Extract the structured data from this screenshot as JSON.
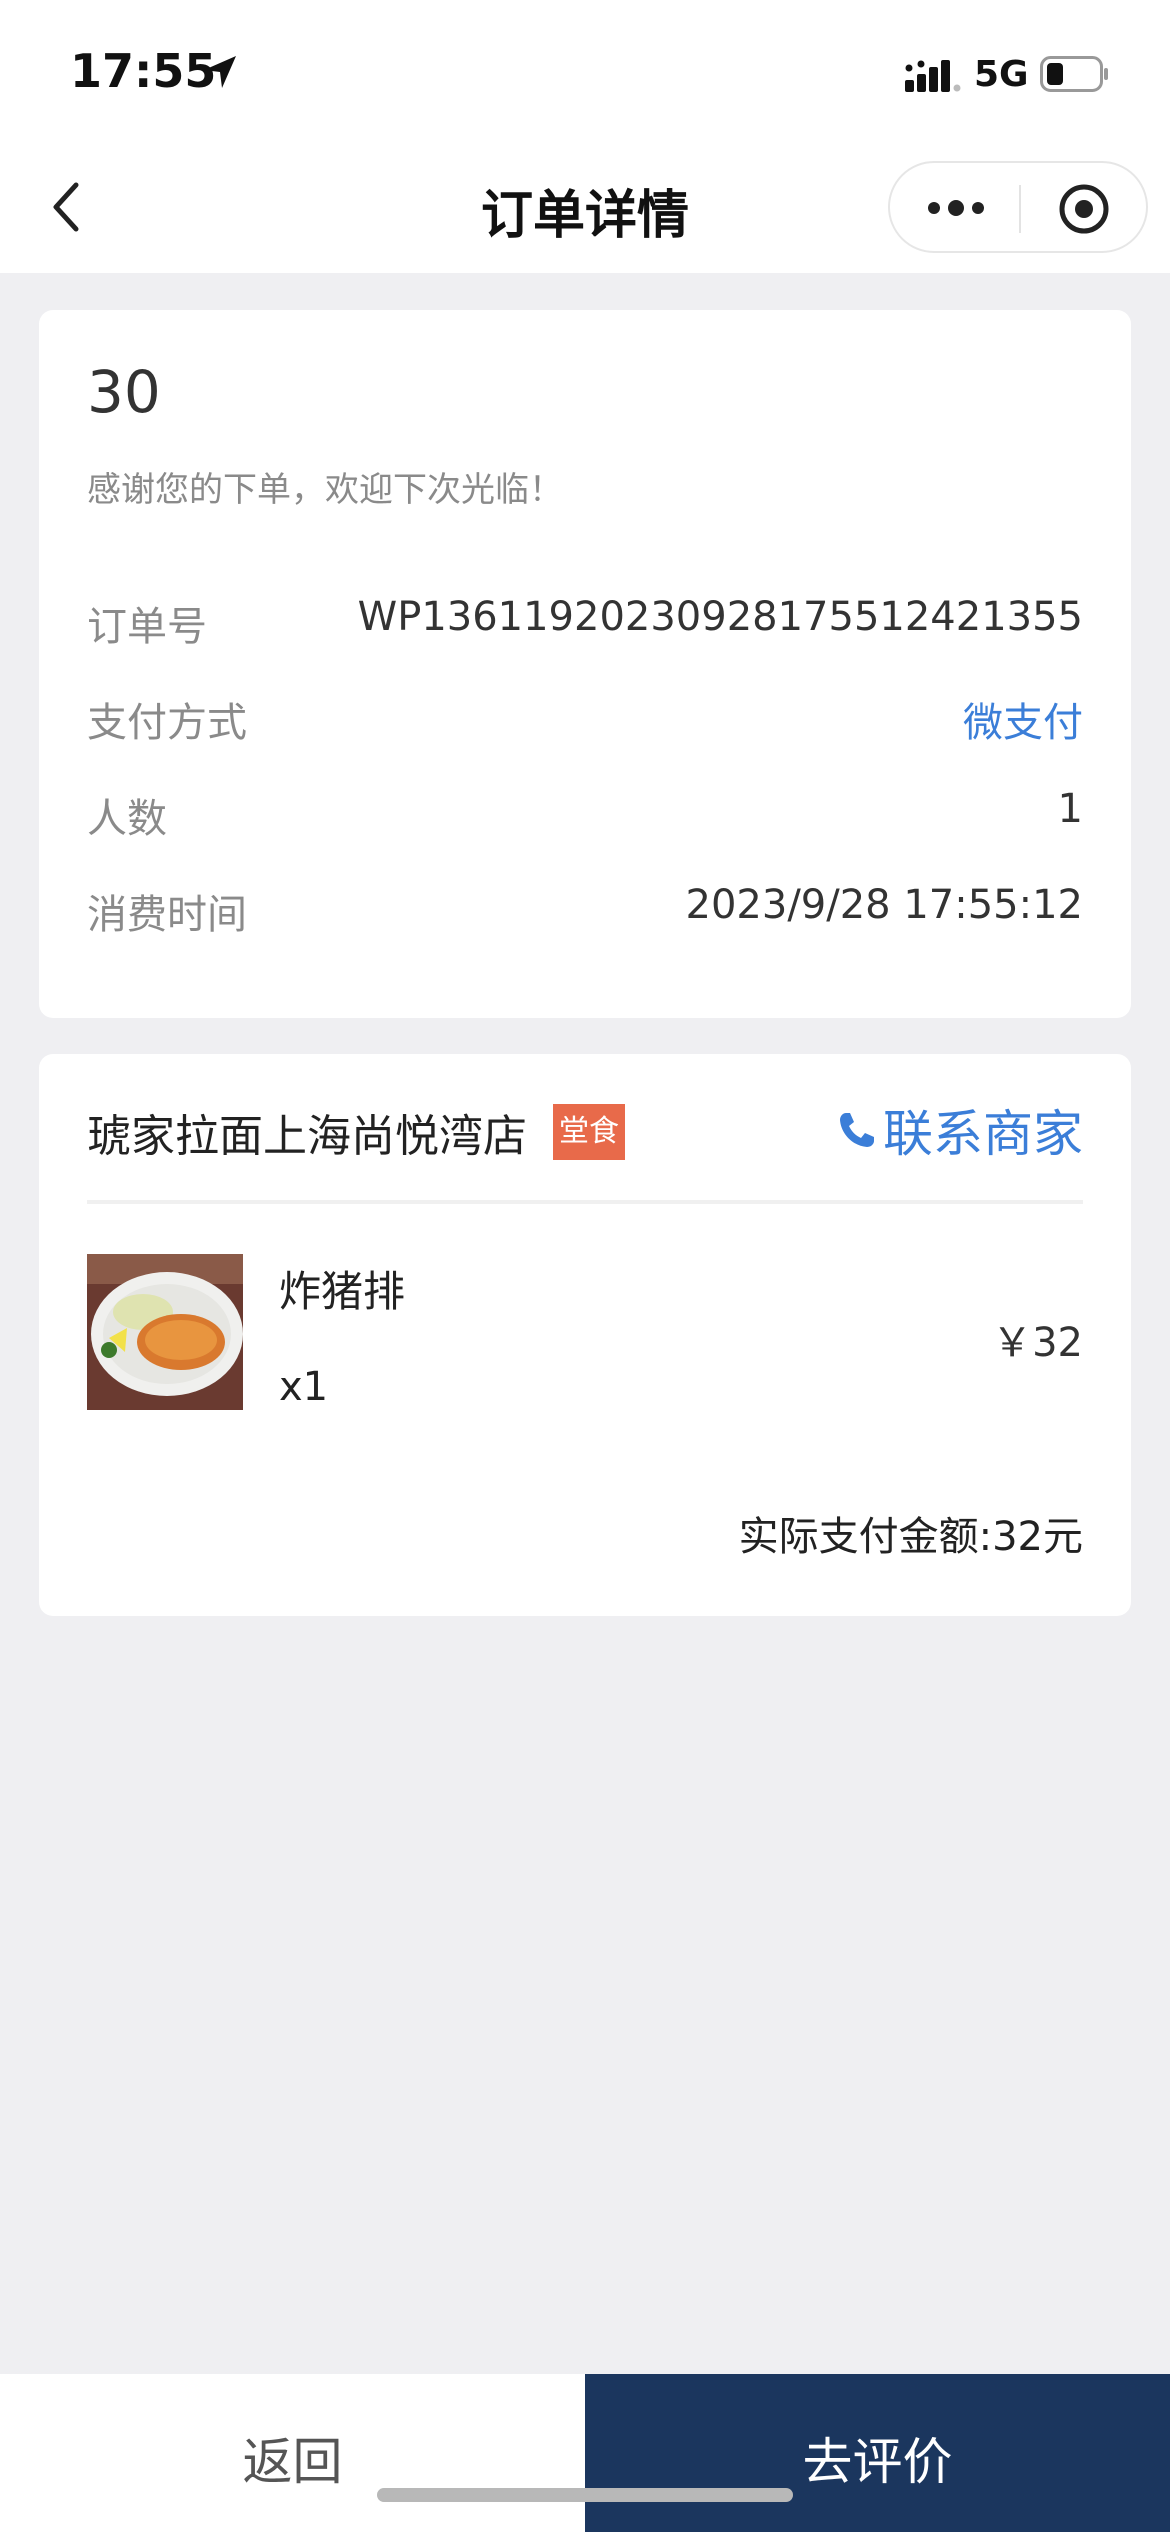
{
  "status_bar": {
    "time": "17:55",
    "network": "5G"
  },
  "nav": {
    "title": "订单详情"
  },
  "order": {
    "status_number": "30",
    "thanks_message": "感谢您的下单，欢迎下次光临！",
    "rows": [
      {
        "label": "订单号",
        "value": "WP1361192023092817551242135​5"
      },
      {
        "label": "支付方式",
        "value": "微支付"
      },
      {
        "label": "人数",
        "value": "1"
      },
      {
        "label": "消费时间",
        "value": "2023/9/28 17:55:12"
      }
    ]
  },
  "store": {
    "name": "琥家拉面上海尚悦湾店",
    "tag": "堂食",
    "contact_label": "联系商家"
  },
  "items": [
    {
      "name": "炸猪排",
      "quantity": "x1",
      "price": "￥32"
    }
  ],
  "summary": {
    "actual_paid": "实际支付金额:32元"
  },
  "bottom": {
    "back_label": "返回",
    "review_label": "去评价"
  },
  "colors": {
    "accent_blue": "#3b7ed8",
    "primary_button": "#1b365e",
    "tag_bg": "#e86a4a",
    "page_bg": "#efeff2"
  }
}
